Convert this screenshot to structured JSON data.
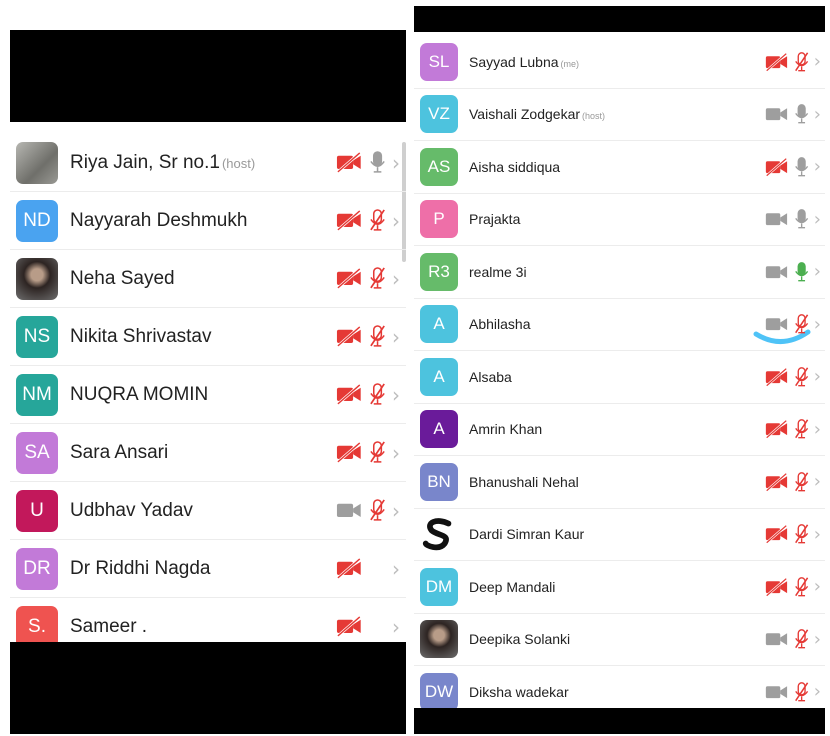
{
  "left_list": {
    "participants": [
      {
        "initials": "",
        "name": "Riya Jain, Sr no.1",
        "tag": "(host)",
        "color": "#8d8d8d",
        "avatar": "photo-gray",
        "video_off": true,
        "mic": "gray",
        "chevron": "›"
      },
      {
        "initials": "ND",
        "name": "Nayyarah Deshmukh",
        "tag": "",
        "color": "#4aa3f0",
        "avatar": "initials",
        "video_off": true,
        "mic": "red",
        "chevron": "›"
      },
      {
        "initials": "",
        "name": "Neha Sayed",
        "tag": "",
        "color": "#555555",
        "avatar": "photo-dark",
        "video_off": true,
        "mic": "red",
        "chevron": "›"
      },
      {
        "initials": "NS",
        "name": "Nikita Shrivastav",
        "tag": "",
        "color": "#26a69a",
        "avatar": "initials",
        "video_off": true,
        "mic": "red",
        "chevron": "›"
      },
      {
        "initials": "NM",
        "name": "NUQRA MOMIN",
        "tag": "",
        "color": "#26a69a",
        "avatar": "initials",
        "video_off": true,
        "mic": "red",
        "chevron": "›"
      },
      {
        "initials": "SA",
        "name": "Sara Ansari",
        "tag": "",
        "color": "#c27ad8",
        "avatar": "initials",
        "video_off": true,
        "mic": "red",
        "chevron": "›"
      },
      {
        "initials": "U",
        "name": "Udbhav Yadav",
        "tag": "",
        "color": "#c2185b",
        "avatar": "initials",
        "video_off": false,
        "mic": "red",
        "chevron": "›"
      },
      {
        "initials": "DR",
        "name": "Dr Riddhi Nagda",
        "tag": "",
        "color": "#c27ad8",
        "avatar": "initials",
        "video_off": true,
        "mic": "none",
        "chevron": "›"
      },
      {
        "initials": "S.",
        "name": "Sameer .",
        "tag": "",
        "color": "#ef5350",
        "avatar": "initials",
        "video_off": true,
        "mic": "none",
        "chevron": "›"
      }
    ]
  },
  "right_list": {
    "participants": [
      {
        "initials": "SL",
        "name": "Sayyad Lubna",
        "tag": "(me)",
        "color": "#c27ad8",
        "avatar": "initials",
        "video_off": true,
        "mic": "red",
        "chevron": "›"
      },
      {
        "initials": "VZ",
        "name": "Vaishali Zodgekar",
        "tag": "(host)",
        "color": "#4dc3de",
        "avatar": "initials",
        "video_off": false,
        "mic": "gray",
        "chevron": "›"
      },
      {
        "initials": "AS",
        "name": "Aisha siddiqua",
        "tag": "",
        "color": "#66bb6a",
        "avatar": "initials",
        "video_off": true,
        "mic": "gray",
        "chevron": "›"
      },
      {
        "initials": "P",
        "name": "Prajakta",
        "tag": "",
        "color": "#ee6fa8",
        "avatar": "initials",
        "video_off": false,
        "mic": "gray",
        "chevron": "›"
      },
      {
        "initials": "R3",
        "name": "realme 3i",
        "tag": "",
        "color": "#66bb6a",
        "avatar": "initials",
        "video_off": false,
        "mic": "green",
        "chevron": "›"
      },
      {
        "initials": "A",
        "name": "Abhilasha",
        "tag": "",
        "color": "#4dc3de",
        "avatar": "initials",
        "video_off": false,
        "mic": "red",
        "chevron": "›"
      },
      {
        "initials": "A",
        "name": "Alsaba",
        "tag": "",
        "color": "#4dc3de",
        "avatar": "initials",
        "video_off": true,
        "mic": "red",
        "chevron": "›"
      },
      {
        "initials": "A",
        "name": "Amrin Khan",
        "tag": "",
        "color": "#6a1b9a",
        "avatar": "initials",
        "video_off": true,
        "mic": "red",
        "chevron": "›"
      },
      {
        "initials": "BN",
        "name": "Bhanushali Nehal",
        "tag": "",
        "color": "#7986cb",
        "avatar": "initials",
        "video_off": true,
        "mic": "red",
        "chevron": "›"
      },
      {
        "initials": "",
        "name": "Dardi Simran Kaur",
        "tag": "",
        "color": "#ffffff",
        "avatar": "logo-s",
        "video_off": true,
        "mic": "red",
        "chevron": "›"
      },
      {
        "initials": "DM",
        "name": "Deep Mandali",
        "tag": "",
        "color": "#4dc3de",
        "avatar": "initials",
        "video_off": true,
        "mic": "red",
        "chevron": "›"
      },
      {
        "initials": "",
        "name": "Deepika Solanki",
        "tag": "",
        "color": "#3a2a28",
        "avatar": "photo-dark",
        "video_off": false,
        "mic": "red",
        "chevron": "›"
      },
      {
        "initials": "DW",
        "name": "Diksha wadekar",
        "tag": "",
        "color": "#7986cb",
        "avatar": "initials",
        "video_off": false,
        "mic": "red",
        "chevron": "›"
      }
    ]
  },
  "colors": {
    "mute_red": "#e53935",
    "icon_gray": "#9e9e9e",
    "talk_green": "#4caf50",
    "spinner": "#4fc3f7"
  }
}
